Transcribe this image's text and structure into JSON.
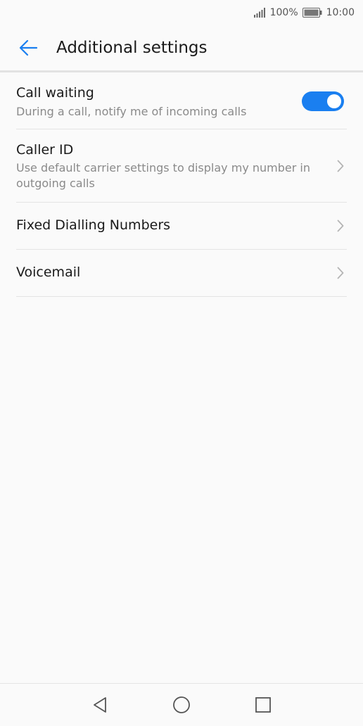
{
  "status_bar": {
    "battery_percent": "100%",
    "time": "10:00"
  },
  "header": {
    "title": "Additional settings"
  },
  "settings": [
    {
      "title": "Call waiting",
      "subtitle": "During a call, notify me of incoming calls",
      "toggle_on": true
    },
    {
      "title": "Caller ID",
      "subtitle": "Use default carrier settings to display my number in outgoing calls"
    },
    {
      "title": "Fixed Dialling Numbers"
    },
    {
      "title": "Voicemail"
    }
  ],
  "colors": {
    "accent": "#1a7ff0",
    "background": "#fafafa"
  }
}
